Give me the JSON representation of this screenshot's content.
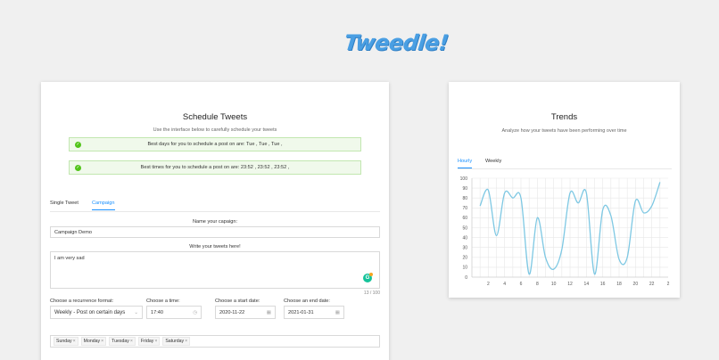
{
  "app": {
    "logo": "Tweedle!"
  },
  "schedule": {
    "title": "Schedule Tweets",
    "subtitle": "Use the interface below to carefully schedule your tweets",
    "best_days": "Best days for you to schedule a post on are:  Tue ,  Tue ,  Tue ,",
    "best_times": "Best times for you to schedule a post on are:  23:52 ,  23:52 ,  23:52 ,",
    "tabs": [
      {
        "label": "Single Tweet",
        "active": false
      },
      {
        "label": "Campaign",
        "active": true
      }
    ],
    "campaign_name_label": "Name your capaign:",
    "campaign_name_value": "Campaign Demo",
    "tweets_label": "Write your tweets here!",
    "tweet_text": "I am very sad",
    "char_counter": "13 / 100",
    "recurrence_label": "Choose a recurrence format:",
    "recurrence_value": "Weekly - Post on certain days",
    "time_label": "Choose a time:",
    "time_value": "17:40",
    "start_label": "Choose a start date:",
    "start_value": "2020-11-22",
    "end_label": "Choose an end date:",
    "end_value": "2021-01-31",
    "days": [
      "Sunday",
      "Monday",
      "Tuesday",
      "Friday",
      "Saturday"
    ]
  },
  "trends": {
    "title": "Trends",
    "subtitle": "Analyze how your tweets have been performing over time",
    "tabs": [
      {
        "label": "Hourly",
        "active": true
      },
      {
        "label": "Weekly",
        "active": false
      }
    ]
  },
  "chart_data": {
    "type": "line",
    "title": "",
    "xlabel": "",
    "ylabel": "",
    "x": [
      1,
      2,
      3,
      4,
      5,
      6,
      7,
      8,
      9,
      10,
      11,
      12,
      13,
      14,
      15,
      16,
      17,
      18,
      19,
      20,
      21,
      22,
      23
    ],
    "values": [
      72,
      88,
      42,
      85,
      80,
      80,
      3,
      60,
      20,
      8,
      28,
      85,
      75,
      85,
      3,
      68,
      62,
      18,
      20,
      77,
      65,
      72,
      96
    ],
    "xticks": [
      0,
      2,
      4,
      6,
      8,
      10,
      12,
      14,
      16,
      18,
      20,
      22,
      24
    ],
    "xtick_labels": [
      "0",
      "2",
      "4",
      "6",
      "8",
      "10",
      "12",
      "14",
      "16",
      "18",
      "20",
      "22",
      "2"
    ],
    "yticks": [
      0,
      10,
      20,
      30,
      40,
      50,
      60,
      70,
      80,
      90,
      100
    ],
    "xlim": [
      0,
      24
    ],
    "ylim": [
      0,
      100
    ],
    "grid": true,
    "colors": {
      "line": "#7ec8e3",
      "grid": "#e8e8e8",
      "axis": "#cfcfcf"
    }
  }
}
